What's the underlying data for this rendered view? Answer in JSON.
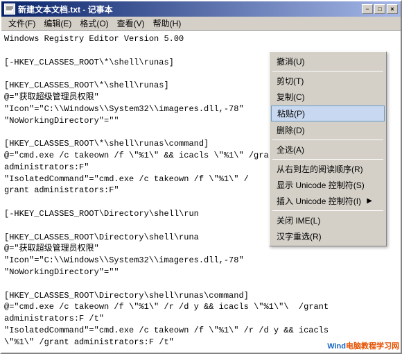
{
  "window": {
    "title": "新建文本文档.txt - 记事本",
    "title_icon": "📄"
  },
  "titlebar": {
    "minimize_label": "−",
    "maximize_label": "□",
    "close_label": "×"
  },
  "menubar": {
    "items": [
      {
        "label": "文件(F)"
      },
      {
        "label": "编辑(E)"
      },
      {
        "label": "格式(O)"
      },
      {
        "label": "查看(V)"
      },
      {
        "label": "帮助(H)"
      }
    ]
  },
  "editor": {
    "content": "Windows Registry Editor Version 5.00\n\n[-HKEY_CLASSES_ROOT\\*\\shell\\runas]\n\n[HKEY_CLASSES_ROOT\\*\\shell\\runas]\n@=\"获取超级管理员权限\"\n\"Icon\"=\"C:\\\\Windows\\\\System32\\\\imageres.dll,-78\"\n\"NoWorkingDirectory\"=\"\"\n\n[HKEY_CLASSES_ROOT\\*\\shell\\runas\\command]\n@=\"cmd.exe /c takeown /f \\\"%1\\\" && icacls administrators:F\"\n\"IsolatedCommand\"=\"cmd.exe /c takeown / && icacls \\\"%1\\\" /\ngrant administrators:F\"\n\n[-HKEY_CLASSES_ROOT\\Directory\\shell\\run\n\n[HKEY_CLASSES_ROOT\\Directory\\shell\\runa\n@=\"获取超级管理员权限\"\n\"Icon\"=\"C:\\\\Windows\\\\System32\\\\imageres.dll,-78\"\n\"NoWorkingDirectory\"=\"\"\n\n[HKEY_CLASSES_ROOT\\Directory\\shell\\runas\\command]\n@=\"cmd.exe /c takeown /f \\\"%1\\\" /r /d y && icacls \\\"%1\\\"  /grant\nadministrators:F /t\"\n\"IsolatedCommand\"=\"cmd.exe /c takeown /f \\\"%1\\\" /r /d y && icacls\n\\\"%1\\\" /grant administrators:F /t\""
  },
  "context_menu": {
    "items": [
      {
        "id": "undo",
        "label": "撤消(U)",
        "shortcut": "",
        "disabled": false,
        "separator_after": false
      },
      {
        "id": "sep1",
        "type": "separator"
      },
      {
        "id": "cut",
        "label": "剪切(T)",
        "shortcut": "",
        "disabled": false,
        "separator_after": false
      },
      {
        "id": "copy",
        "label": "复制(C)",
        "shortcut": "",
        "disabled": false,
        "separator_after": false
      },
      {
        "id": "paste",
        "label": "粘贴(P)",
        "shortcut": "",
        "disabled": false,
        "highlighted": true,
        "separator_after": false
      },
      {
        "id": "delete",
        "label": "删除(D)",
        "shortcut": "",
        "disabled": false,
        "separator_after": false
      },
      {
        "id": "sep2",
        "type": "separator"
      },
      {
        "id": "selectall",
        "label": "全选(A)",
        "shortcut": "",
        "disabled": false,
        "separator_after": false
      },
      {
        "id": "sep3",
        "type": "separator"
      },
      {
        "id": "rtl",
        "label": "从右到左的阅读顺序(R)",
        "shortcut": "",
        "disabled": false,
        "separator_after": false
      },
      {
        "id": "show_unicode_ctrl",
        "label": "显示 Unicode 控制符(S)",
        "shortcut": "",
        "disabled": false,
        "separator_after": false
      },
      {
        "id": "insert_unicode_ctrl",
        "label": "插入 Unicode 控制符(I)",
        "shortcut": "",
        "disabled": false,
        "has_arrow": true,
        "separator_after": false
      },
      {
        "id": "sep4",
        "type": "separator"
      },
      {
        "id": "close_ime",
        "label": "关闭 IME(L)",
        "shortcut": "",
        "disabled": false,
        "separator_after": false
      },
      {
        "id": "reconvert",
        "label": "汉字重选(R)",
        "shortcut": "",
        "disabled": false,
        "separator_after": false
      }
    ]
  },
  "watermark": {
    "text1": "Wind",
    "text2": "电脑教程学习网"
  }
}
